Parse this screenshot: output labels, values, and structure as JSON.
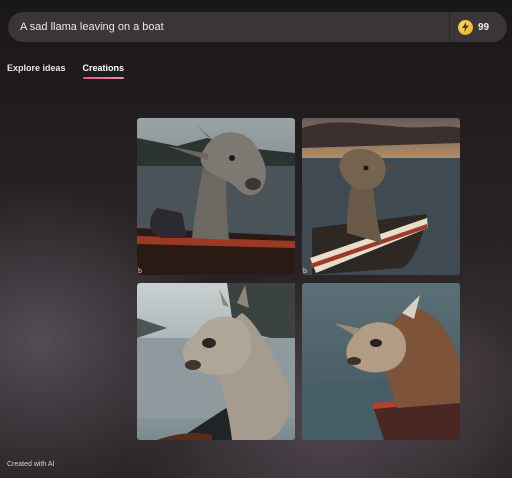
{
  "search": {
    "value": "A sad llama leaving on a boat"
  },
  "boosts": {
    "count": "99",
    "icon": "lightning-bolt-icon",
    "color": "#f0b429"
  },
  "tabs": [
    {
      "label": "Explore ideas",
      "active": false
    },
    {
      "label": "Creations",
      "active": true
    }
  ],
  "accent_color": "#e05a78",
  "images": [
    {
      "description": "llama in boat on lake",
      "corner_mark": "b"
    },
    {
      "description": "llama in wooden boat at sunset",
      "corner_mark": "b"
    },
    {
      "description": "fluffy llama on boat by lake",
      "corner_mark": ""
    },
    {
      "description": "brown llama near boat on water",
      "corner_mark": ""
    }
  ],
  "footer": {
    "text": "Created with AI"
  }
}
